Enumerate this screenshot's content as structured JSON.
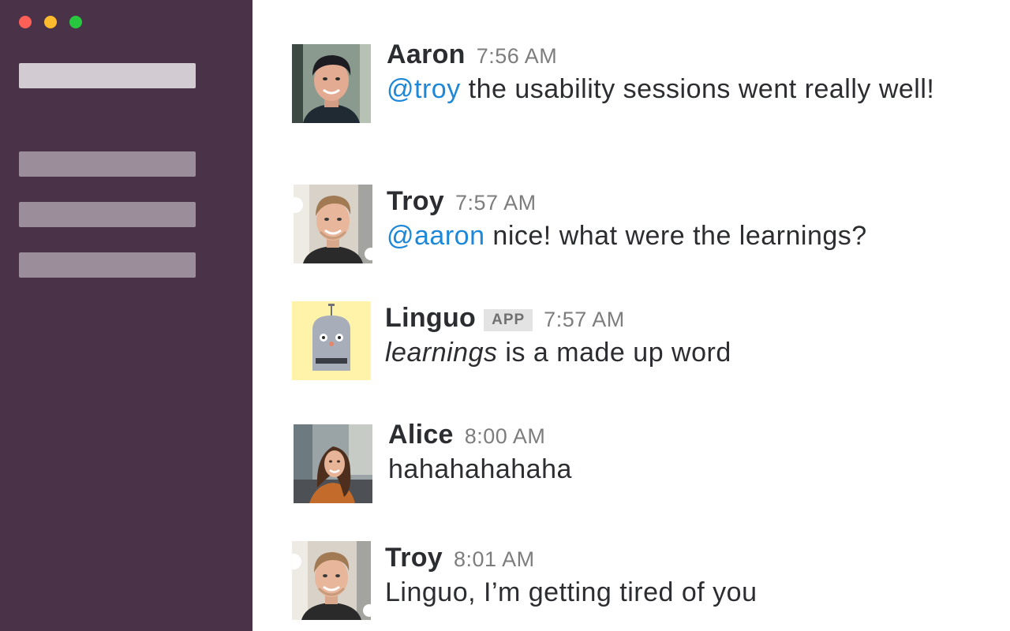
{
  "window": {
    "buttons": [
      "close",
      "minimize",
      "zoom"
    ],
    "colors": {
      "close": "#fe5f57",
      "minimize": "#febb2e",
      "zoom": "#27c840"
    }
  },
  "sidebar": {
    "background": "#4a3249"
  },
  "messages": [
    {
      "author": "Aaron",
      "time": "7:56 AM",
      "mention": "@troy",
      "text": " the usability sessions went really well!",
      "avatar": "aaron-avatar"
    },
    {
      "author": "Troy",
      "time": "7:57 AM",
      "mention": "@aaron",
      "text": " nice! what were the learnings?",
      "avatar": "troy-avatar"
    },
    {
      "author": "Linguo",
      "badge": "APP",
      "time": "7:57 AM",
      "emphasis": "learnings",
      "text": " is a made up word",
      "avatar": "robot-avatar"
    },
    {
      "author": "Alice",
      "time": "8:00 AM",
      "text": "hahahahahaha",
      "avatar": "alice-avatar"
    },
    {
      "author": "Troy",
      "time": "8:01 AM",
      "text": "Linguo, I’m getting tired of you",
      "avatar": "troy-avatar"
    }
  ],
  "colors": {
    "mention": "#1e88d8",
    "author": "#2c2d30",
    "timestamp": "#7d7d7d"
  }
}
